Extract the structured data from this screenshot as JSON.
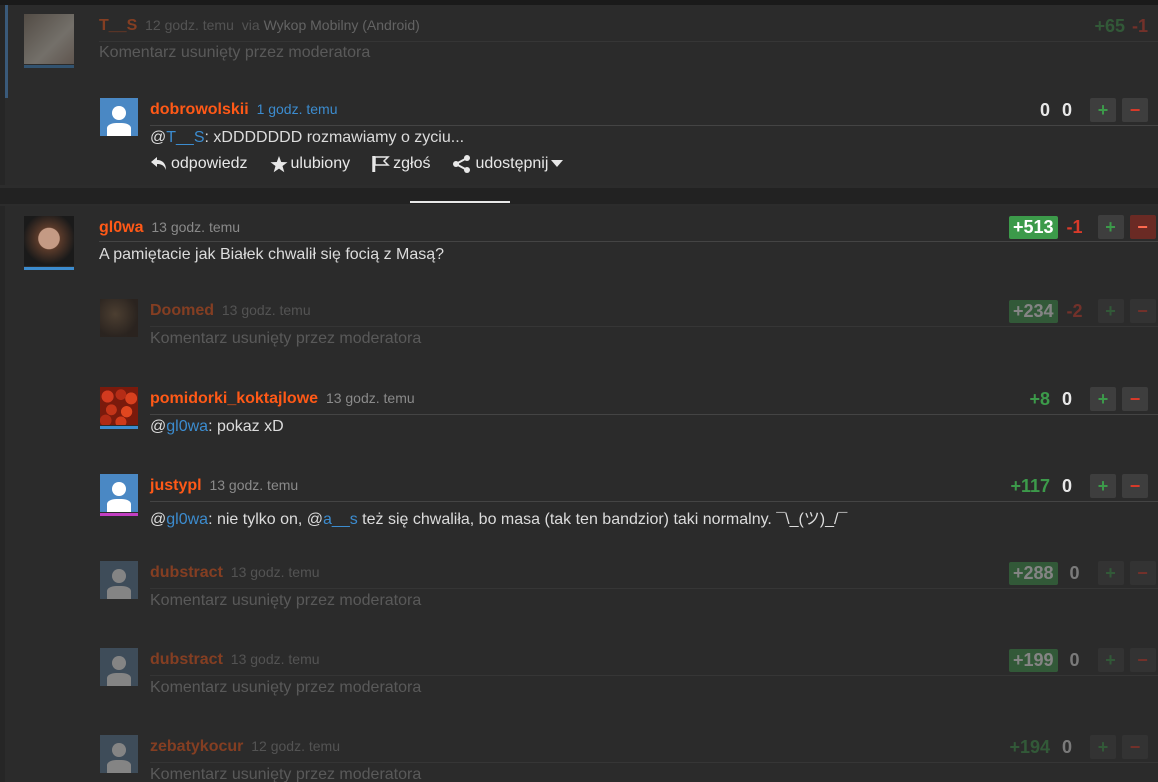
{
  "thread1": {
    "parent": {
      "user": "T__S",
      "time": "12 godz. temu",
      "via_prefix": "via",
      "via_app": "Wykop Mobilny (Android)",
      "body": "Komentarz usunięty przez moderatora",
      "plus": "+65",
      "minus": "-1"
    },
    "reply": {
      "user": "dobrowolskii",
      "time": "1 godz. temu",
      "mention": "T__S",
      "mention_prefix": "@",
      "text": ": xDDDDDDD rozmawiamy o zyciu...",
      "plus": "0",
      "minus": "0",
      "actions": {
        "reply": "odpowiedz",
        "favorite": "ulubiony",
        "report": "zgłoś",
        "share": "udostępnij"
      }
    }
  },
  "thread2": {
    "parent": {
      "user": "gl0wa",
      "time": "13 godz. temu",
      "body": "A pamiętacie jak Białek chwalił się focią z Masą?",
      "plus": "+513",
      "minus": "-1"
    },
    "replies": [
      {
        "user": "Doomed",
        "time": "13 godz. temu",
        "body": "Komentarz usunięty przez moderatora",
        "plus": "+234",
        "minus": "-2"
      },
      {
        "user": "pomidorki_koktajlowe",
        "time": "13 godz. temu",
        "mention": "gl0wa",
        "text": ": pokaz xD",
        "plus": "+8",
        "minus": "0"
      },
      {
        "user": "justypl",
        "time": "13 godz. temu",
        "mention": "gl0wa",
        "text_a": ": nie tylko on, @",
        "mention2": "a__s",
        "text_b": " też się chwaliła, bo masa (tak ten bandzior) taki normalny. ¯\\_(ツ)_/¯",
        "plus": "+117",
        "minus": "0"
      },
      {
        "user": "dubstract",
        "time": "13 godz. temu",
        "body": "Komentarz usunięty przez moderatora",
        "plus": "+288",
        "minus": "0"
      },
      {
        "user": "dubstract",
        "time": "13 godz. temu",
        "body": "Komentarz usunięty przez moderatora",
        "plus": "+199",
        "minus": "0"
      },
      {
        "user": "zebatykocur",
        "time": "12 godz. temu",
        "body": "Komentarz usunięty przez moderatora",
        "plus": "+194",
        "minus": "0"
      }
    ]
  },
  "colors": {
    "username": "#ff5917",
    "mention": "#3c8ccf",
    "plus": "#3c9a4a",
    "minus": "#d83a2a"
  }
}
